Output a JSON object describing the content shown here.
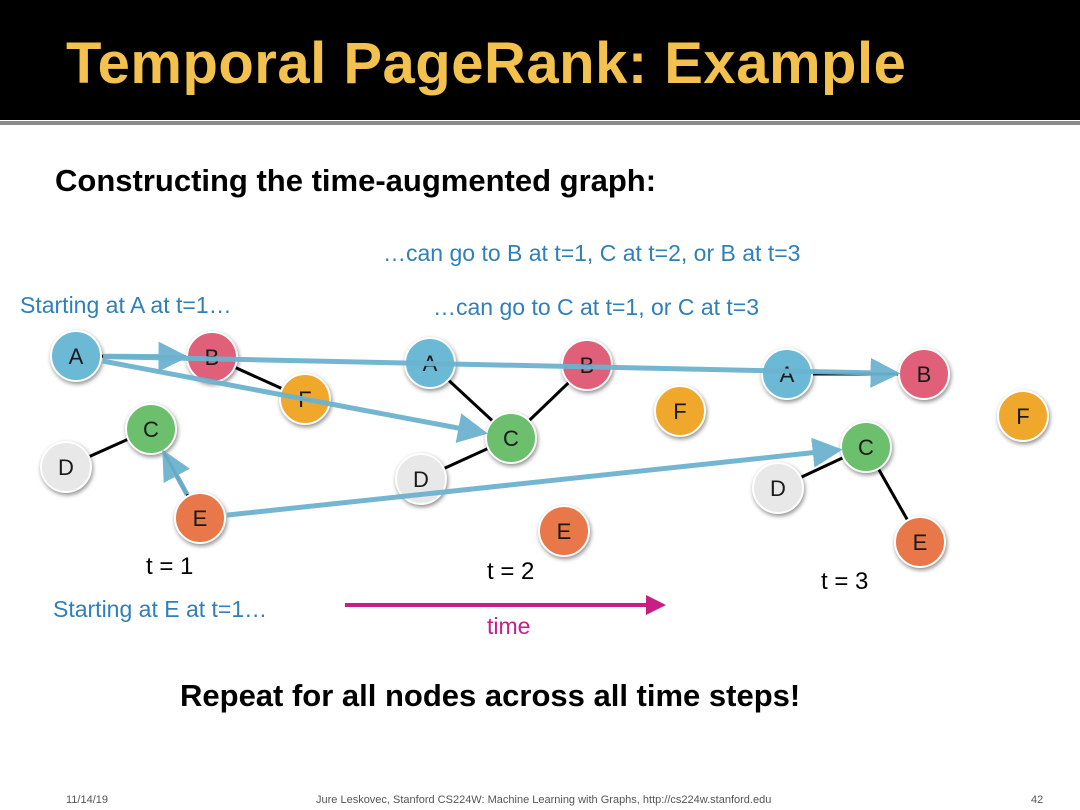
{
  "title": "Temporal PageRank: Example",
  "subtitle": "Constructing the time-augmented graph:",
  "notes": {
    "a_paths": "…can go to B at t=1, C at t=2, or B at t=3",
    "start_a": "Starting at A at t=1…",
    "e_paths": "…can go to C at t=1, or C at t=3",
    "start_e": "Starting at E at t=1…"
  },
  "time_labels": {
    "t1": "t = 1",
    "t2": "t = 2",
    "t3": "t = 3"
  },
  "time_axis_label": "time",
  "bottom_text": "Repeat for all nodes across all time steps!",
  "footer": {
    "date": "11/14/19",
    "credit": "Jure Leskovec, Stanford CS224W: Machine Learning with Graphs, http://cs224w.stanford.edu",
    "page": "42"
  },
  "node_colors": {
    "A": "#6bb9d4",
    "B": "#e0607a",
    "C": "#6cbf6c",
    "D": "#e8e8e8",
    "E": "#e8784a",
    "F": "#f0a82c"
  },
  "snapshots": [
    {
      "time": 1,
      "nodes": [
        "A",
        "B",
        "C",
        "D",
        "E",
        "F"
      ],
      "edges": [
        [
          "A",
          "B"
        ],
        [
          "B",
          "F"
        ],
        [
          "C",
          "D"
        ],
        [
          "C",
          "E"
        ]
      ]
    },
    {
      "time": 2,
      "nodes": [
        "A",
        "B",
        "C",
        "D",
        "E",
        "F"
      ],
      "edges": [
        [
          "A",
          "C"
        ],
        [
          "B",
          "C"
        ],
        [
          "C",
          "D"
        ]
      ]
    },
    {
      "time": 3,
      "nodes": [
        "A",
        "B",
        "C",
        "D",
        "E",
        "F"
      ],
      "edges": [
        [
          "A",
          "B"
        ],
        [
          "C",
          "D"
        ],
        [
          "C",
          "E"
        ]
      ]
    }
  ],
  "transitions": [
    {
      "from": "A@1",
      "to": "B@1"
    },
    {
      "from": "A@1",
      "to": "B@3"
    },
    {
      "from": "A@1",
      "to": "C@2"
    },
    {
      "from": "E@1",
      "to": "C@1"
    },
    {
      "from": "E@1",
      "to": "C@3"
    }
  ],
  "colors": {
    "arrow": "#6db3cf",
    "time_arrow": "#c81f87",
    "note_text": "#2f7fb8",
    "title_text": "#f2c14e"
  }
}
